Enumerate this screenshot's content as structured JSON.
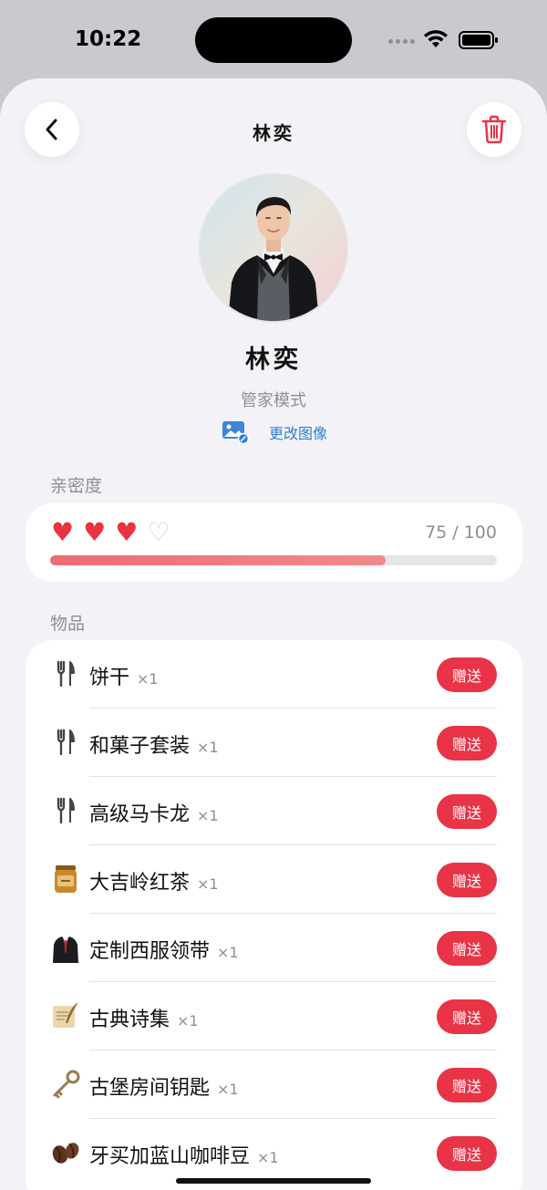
{
  "status": {
    "time": "10:22"
  },
  "header": {
    "title": "林奕"
  },
  "profile": {
    "name": "林奕",
    "mode": "管家模式",
    "change_photo_label": "更改图像"
  },
  "intimacy": {
    "section_title": "亲密度",
    "value_text": "75 / 100",
    "value": 75,
    "max": 100,
    "hearts_filled": 3,
    "hearts_total": 4
  },
  "items": {
    "section_title": "物品",
    "gift_label": "赠送",
    "list": [
      {
        "name": "饼干",
        "qty": "×1",
        "icon": "fork-knife-icon"
      },
      {
        "name": "和菓子套装",
        "qty": "×1",
        "icon": "fork-knife-icon"
      },
      {
        "name": "高级马卡龙",
        "qty": "×1",
        "icon": "fork-knife-icon"
      },
      {
        "name": "大吉岭红茶",
        "qty": "×1",
        "icon": "tea-tin-icon"
      },
      {
        "name": "定制西服领带",
        "qty": "×1",
        "icon": "suit-icon"
      },
      {
        "name": "古典诗集",
        "qty": "×1",
        "icon": "scroll-quill-icon"
      },
      {
        "name": "古堡房间钥匙",
        "qty": "×1",
        "icon": "old-key-icon"
      },
      {
        "name": "牙买加蓝山咖啡豆",
        "qty": "×1",
        "icon": "coffee-beans-icon"
      }
    ]
  },
  "colors": {
    "accent_red": "#e83446",
    "link_blue": "#2d7fd3",
    "heart_red": "#e8343e",
    "progress_fill": "#ee6b72"
  }
}
